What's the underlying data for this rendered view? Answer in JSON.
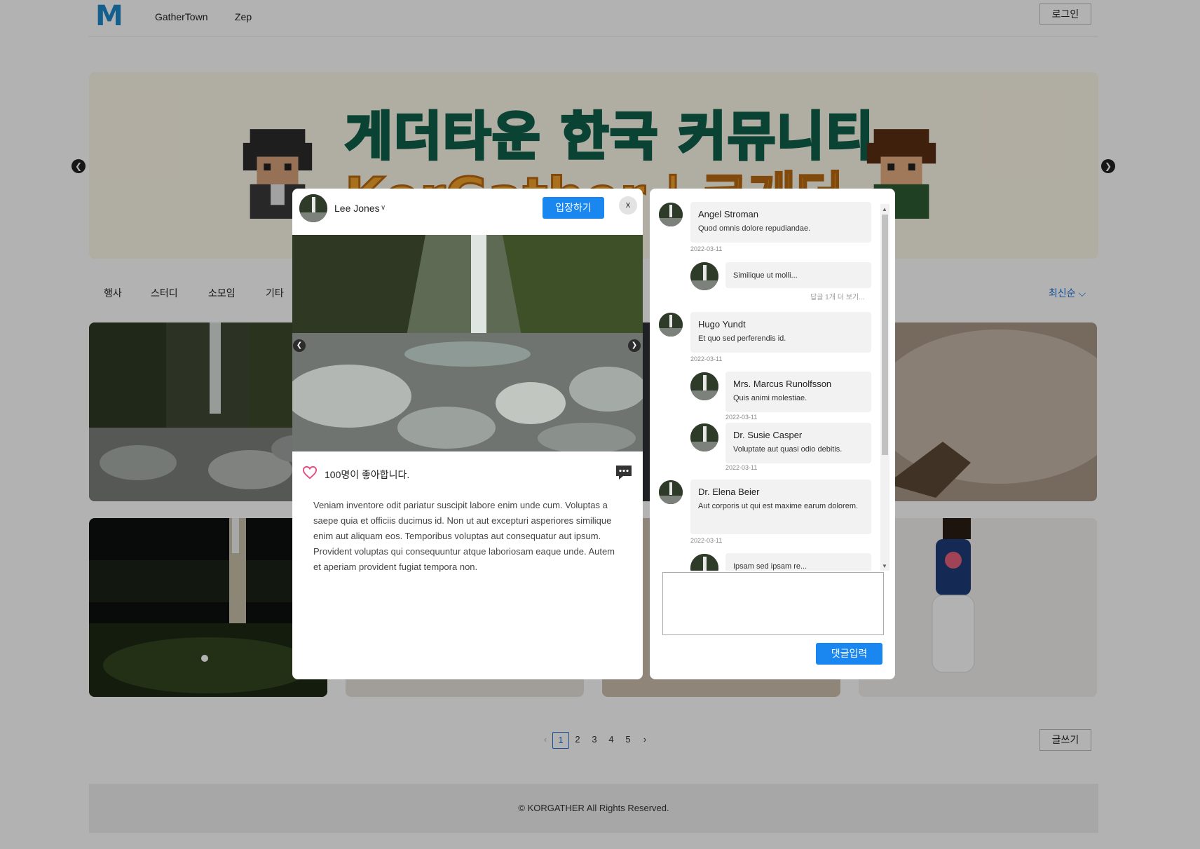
{
  "header": {
    "logo": "M",
    "nav": [
      "GatherTown",
      "Zep"
    ],
    "login_label": "로그인"
  },
  "banner": {
    "title": "게더타운 한국 커뮤니티",
    "subtitle": "KorGather | 코게더"
  },
  "categories": [
    "행사",
    "스터디",
    "소모임",
    "기타"
  ],
  "sort_label": "최신순",
  "pagination": {
    "pages": [
      "1",
      "2",
      "3",
      "4",
      "5"
    ],
    "current": "1",
    "prev_icon": "‹",
    "next_icon": "›"
  },
  "write_label": "글쓰기",
  "footer": {
    "text": "© KORGATHER All Rights Reserved."
  },
  "post": {
    "author": "Lee Jones",
    "enter_label": "입장하기",
    "close_label": "x",
    "likes_text": "100명이 좋아합니다.",
    "body": "Veniam inventore odit pariatur suscipit labore enim unde cum. Voluptas a saepe quia et officiis ducimus id. Non ut aut excepturi asperiores similique enim aut aliquam eos. Temporibus voluptas aut consequatur aut ipsum. Provident voluptas qui consequuntur atque laboriosam eaque unde. Autem et aperiam provident fugiat tempora non."
  },
  "comments": {
    "items": [
      {
        "name": "Angel Stroman",
        "text": "Quod omnis dolore repudiandae.",
        "date": "2022-03-11"
      },
      {
        "name": "",
        "text": "Similique ut molli...",
        "date": ""
      },
      {
        "more": "답글 1개 더 보기..."
      },
      {
        "name": "Hugo Yundt",
        "text": "Et quo sed perferendis id.",
        "date": "2022-03-11"
      },
      {
        "name": "Mrs. Marcus Runolfsson",
        "text": "Quis animi molestiae.",
        "date": "2022-03-11"
      },
      {
        "name": "Dr. Susie Casper",
        "text": "Voluptate aut quasi odio debitis.",
        "date": "2022-03-11"
      },
      {
        "name": "Dr. Elena Beier",
        "text": "Aut corporis ut qui est maxime earum dolorem.",
        "date": "2022-03-11"
      },
      {
        "name": "",
        "text": "Ipsam sed ipsam re...",
        "date": ""
      }
    ],
    "input_value": "",
    "submit_label": "댓글입력"
  },
  "colors": {
    "primary": "#1a87f0",
    "brand": "#1e88c9",
    "like": "#e8477e"
  }
}
